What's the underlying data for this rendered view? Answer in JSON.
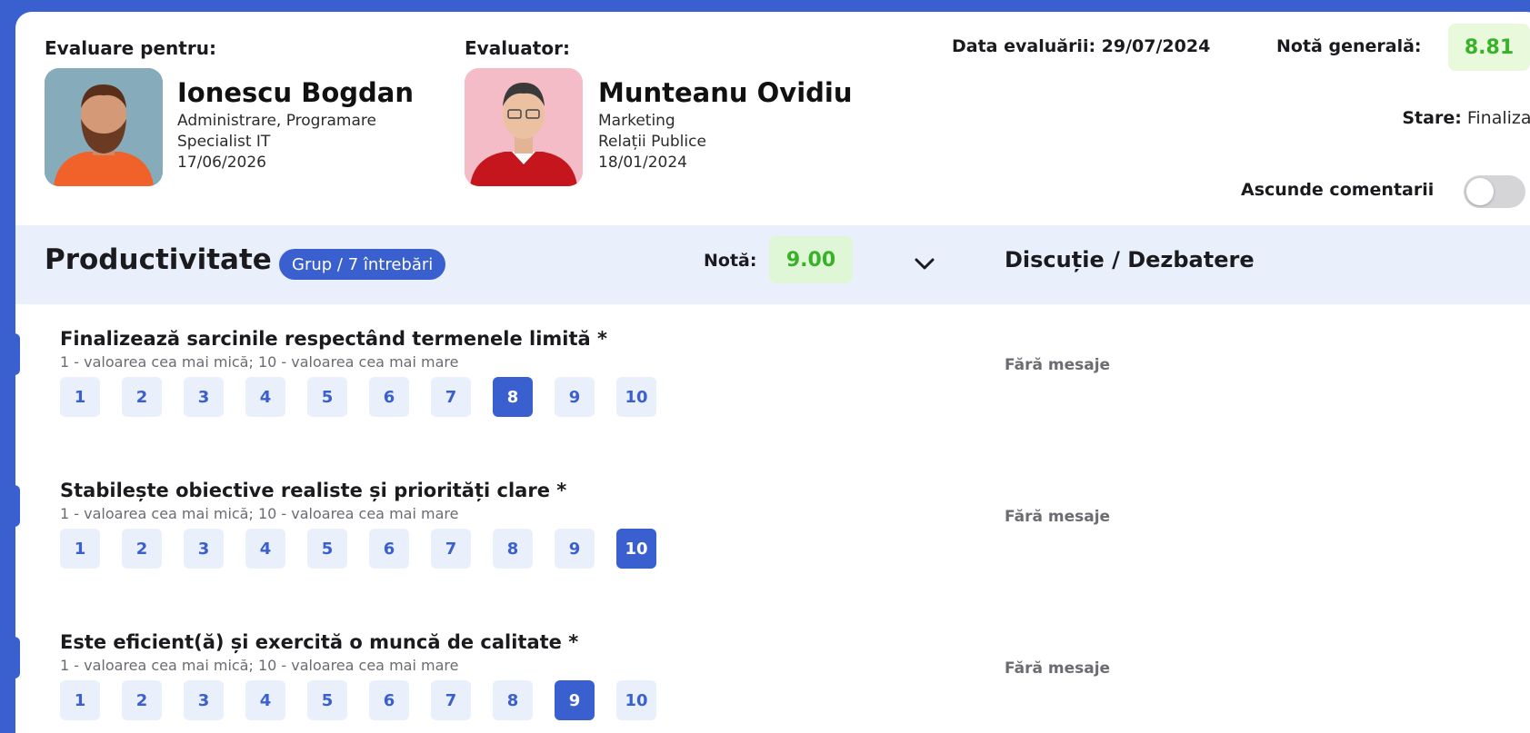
{
  "header": {
    "evaluee_label": "Evaluare pentru:",
    "evaluator_label": "Evaluator:",
    "evaluee": {
      "name": "Ionescu Bogdan",
      "department": "Administrare, Programare",
      "role": "Specialist IT",
      "date": "17/06/2026"
    },
    "evaluator": {
      "name": "Munteanu Ovidiu",
      "department": "Marketing",
      "role": "Relații Publice",
      "date": "18/01/2024"
    },
    "evaluation_date": "Data evaluării: 29/07/2024",
    "overall_label": "Notă generală:",
    "overall_value": "8.81",
    "status_label": "Stare:",
    "status_value": " Finalizat",
    "hide_comments_label": "Ascunde comentarii",
    "hide_comments_on": false
  },
  "section": {
    "title": "Productivitate",
    "badge": "Grup / 7 întrebări",
    "nota_label": "Notă:",
    "nota_value": "9.00",
    "discussion_title": "Discuție / Dezbatere"
  },
  "questions": [
    {
      "title": "Finalizează sarcinile respectând termenele limită *",
      "subtitle": "1 - valoarea cea mai mică; 10 - valoarea cea mai mare",
      "selected": 8,
      "messages": "Fără mesaje"
    },
    {
      "title": "Stabilește obiective realiste și priorități clare *",
      "subtitle": "1 - valoarea cea mai mică; 10 - valoarea cea mai mare",
      "selected": 10,
      "messages": "Fără mesaje"
    },
    {
      "title": "Este eficient(ă) și exercită o muncă de calitate *",
      "subtitle": "1 - valoarea cea mai mică; 10 - valoarea cea mai mare",
      "selected": 9,
      "messages": "Fără mesaje"
    }
  ],
  "scale": [
    "1",
    "2",
    "3",
    "4",
    "5",
    "6",
    "7",
    "8",
    "9",
    "10"
  ],
  "colors": {
    "accent": "#3a5fcf",
    "score_green": "#39b22a",
    "score_bg": "#e8f9dc",
    "section_bg": "#eaf0fb"
  }
}
